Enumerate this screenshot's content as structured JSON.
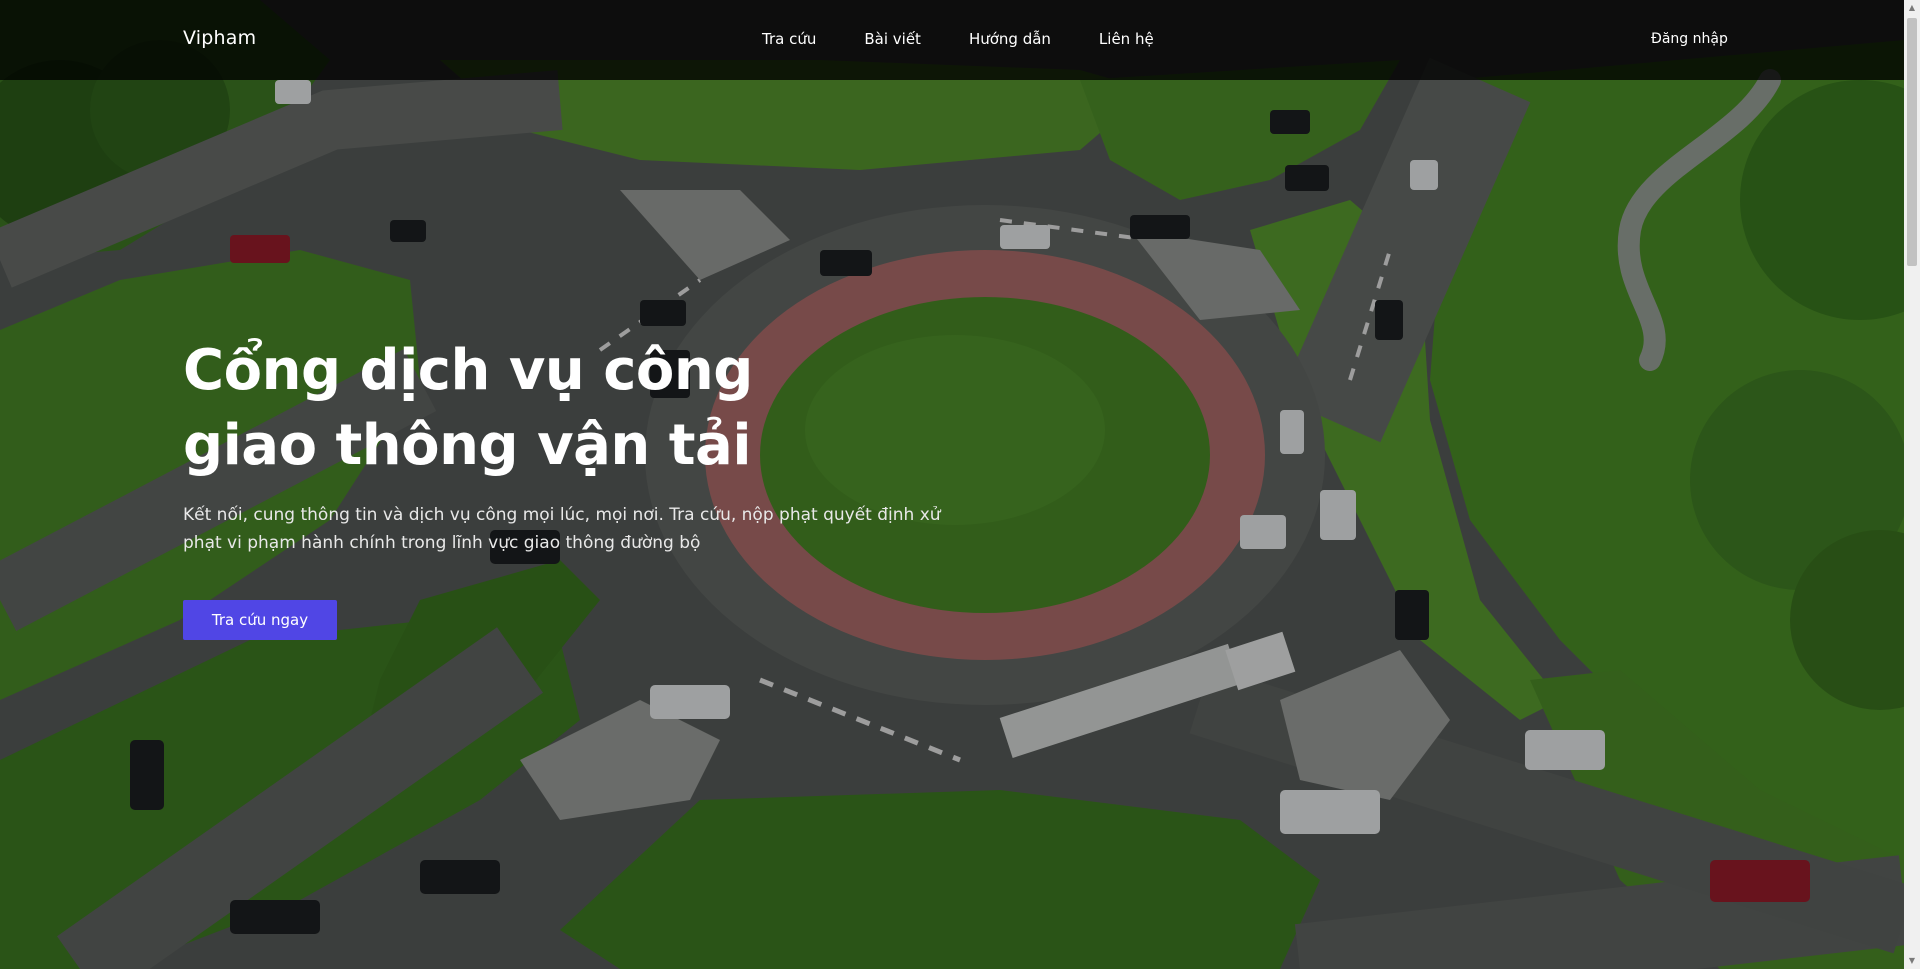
{
  "navbar": {
    "brand": "Vipham",
    "links": [
      "Tra cứu",
      "Bài viết",
      "Hướng dẫn",
      "Liên hệ"
    ],
    "login": "Đăng nhập"
  },
  "hero": {
    "title": "Cổng dịch vụ công giao thông vận tải",
    "description": "Kết nối, cung thông tin và dịch vụ công mọi lúc, mọi nơi. Tra cứu, nộp phạt quyết định xử phạt vi phạm hành chính trong lĩnh vực giao thông đường bộ",
    "cta_label": "Tra cứu ngay",
    "background": "aerial roundabout intersection photo"
  },
  "colors": {
    "accent": "#5046e5",
    "navbar_bg": "rgba(0,0,0,0.78)",
    "text": "#ffffff"
  }
}
